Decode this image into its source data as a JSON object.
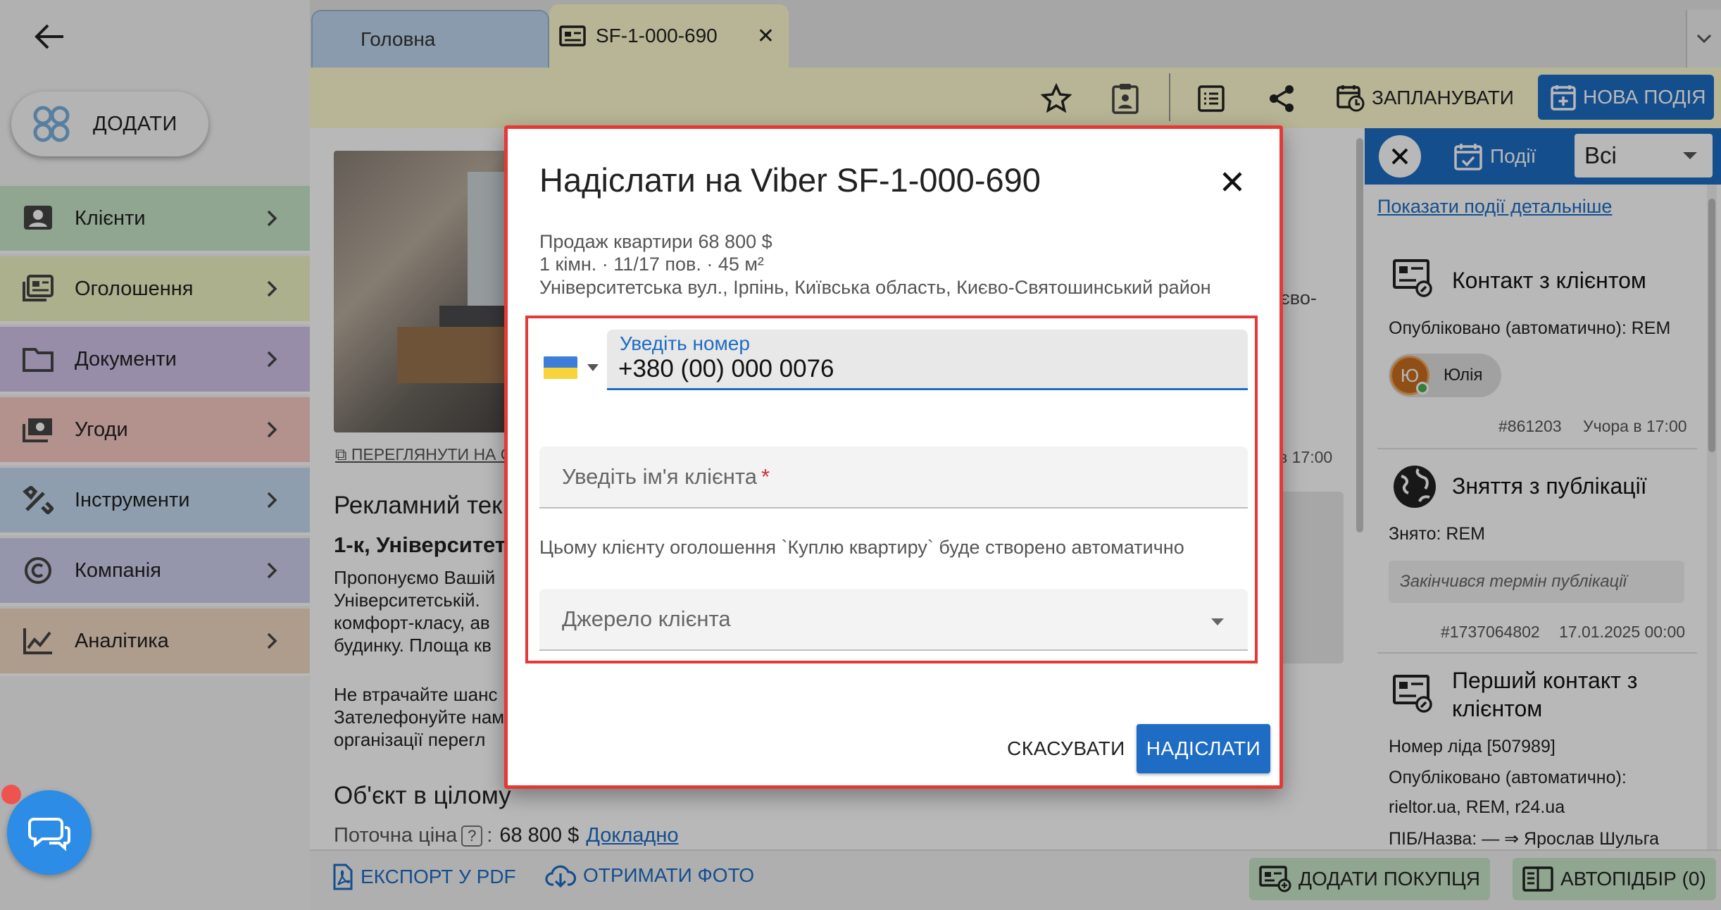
{
  "sidebar": {
    "add_label": "ДОДАТИ",
    "items": [
      {
        "label": "Клієнти",
        "color": "#c8e6c9"
      },
      {
        "label": "Оголошення",
        "color": "#f0f4c3"
      },
      {
        "label": "Документи",
        "color": "#d1c4e9"
      },
      {
        "label": "Угоди",
        "color": "#f8c9c4"
      },
      {
        "label": "Інструменти",
        "color": "#c5dcf2"
      },
      {
        "label": "Компанія",
        "color": "#cfcfee"
      },
      {
        "label": "Аналітика",
        "color": "#f2d8c2"
      }
    ]
  },
  "tabs": {
    "home": "Головна",
    "listing": "SF-1-000-690"
  },
  "toolbar": {
    "schedule": "ЗАПЛАНУВАТИ",
    "new_event": "НОВА ПОДІЯ"
  },
  "main": {
    "view_link": "ПЕРЕГЛЯНУТИ НА С",
    "ad_text_title": "Рекламний тек",
    "ad_headline": "1-к, Університетс",
    "para1": [
      "Пропонуємо Вашій",
      "Університетській.",
      "комфорт-класу, ав",
      "будинку. Площа кв"
    ],
    "para2": [
      "Не втрачайте шанс",
      "Зателефонуйте нам",
      "організації перегл"
    ],
    "object_title": "Об'єкт в цілому",
    "price_label": "Поточна ціна",
    "price_value": "68 800 $",
    "price_more": "Докладно",
    "side_fragment_1": "єво-",
    "side_fragment_2": "в 17:00"
  },
  "bottom": {
    "export_pdf": "ЕКСПОРТ У PDF",
    "get_photo": "ОТРИМАТИ ФОТО",
    "add_buyer": "ДОДАТИ ПОКУПЦЯ",
    "autoselect": "АВТОПІДБІР (0)"
  },
  "events": {
    "tab": "Події",
    "filter": "Всі",
    "detail_link": "Показати події детальніше",
    "cards": [
      {
        "title": "Контакт з клієнтом",
        "line1": "Опубліковано (автоматично): REM",
        "user": "Юлія",
        "user_initial": "Ю",
        "id": "#861203",
        "time": "Учора в 17:00"
      },
      {
        "title": "Зняття з публікації",
        "line1": "Знято: REM",
        "note": "Закінчився термін публікації",
        "id": "#1737064802",
        "time": "17.01.2025 00:00"
      },
      {
        "title_line1": "Перший контакт з",
        "title_line2": "клієнтом",
        "line1": "Номер ліда [507989]",
        "line2": "Опубліковано (автоматично):",
        "line3": "rieltor.ua, REM, r24.ua",
        "line4": "ПІБ/Назва: — ⇒ Ярослав Шульга"
      }
    ]
  },
  "dialog": {
    "title": "Надіслати на Viber SF-1-000-690",
    "info_line1": "Продаж квартири 68 800 $",
    "info_line2": "1 кімн. · 11/17 пов. · 45 м²",
    "info_line3": "Університетська вул., Ірпінь, Київська область, Києво-Святошинський район",
    "phone_label": "Уведіть номер",
    "phone_value": "+380 (00) 000 0076",
    "name_placeholder": "Уведіть ім'я клієнта",
    "required_mark": "*",
    "auto_note": "Цьому клієнту оголошення `Куплю квартиру` буде створено автоматично",
    "source_placeholder": "Джерело клієнта",
    "cancel": "СКАСУВАТИ",
    "send": "НАДІСЛАТИ"
  }
}
